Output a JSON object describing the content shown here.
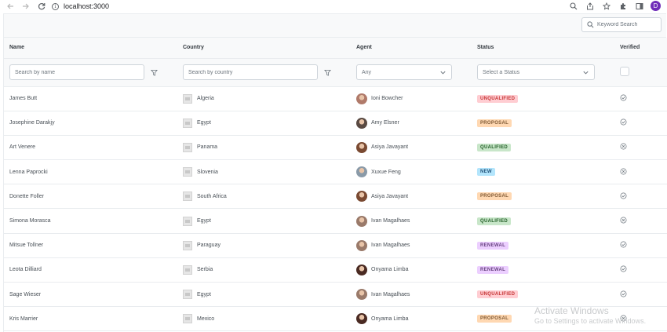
{
  "browser": {
    "url": "localhost:3000",
    "profile_initial": "D",
    "profile_color": "#6f2db8"
  },
  "search": {
    "placeholder": "Keyword Search"
  },
  "columns": {
    "name": "Name",
    "country": "Country",
    "agent": "Agent",
    "status": "Status",
    "verified": "Verified"
  },
  "filters": {
    "name_placeholder": "Search by name",
    "country_placeholder": "Search by country",
    "agent_value": "Any",
    "status_value": "Select a Status"
  },
  "rows": [
    {
      "name": "James Butt",
      "country": "Algeria",
      "agent": "Ioni Bowcher",
      "agent_color": "#b07a6a",
      "status": "UNQUALIFIED",
      "verified": true
    },
    {
      "name": "Josephine Darakjy",
      "country": "Egypt",
      "agent": "Amy Elsner",
      "agent_color": "#5a4a42",
      "status": "PROPOSAL",
      "verified": true
    },
    {
      "name": "Art Venere",
      "country": "Panama",
      "agent": "Asiya Javayant",
      "agent_color": "#7a4a32",
      "status": "QUALIFIED",
      "verified": false
    },
    {
      "name": "Lenna Paprocki",
      "country": "Slovenia",
      "agent": "Xuxue Feng",
      "agent_color": "#8a9aa8",
      "status": "NEW",
      "verified": false
    },
    {
      "name": "Donette Foller",
      "country": "South Africa",
      "agent": "Asiya Javayant",
      "agent_color": "#7a4a32",
      "status": "PROPOSAL",
      "verified": true
    },
    {
      "name": "Simona Morasca",
      "country": "Egypt",
      "agent": "Ivan Magalhaes",
      "agent_color": "#9a7a6a",
      "status": "QUALIFIED",
      "verified": false
    },
    {
      "name": "Mitsue Tollner",
      "country": "Paraguay",
      "agent": "Ivan Magalhaes",
      "agent_color": "#9a7a6a",
      "status": "RENEWAL",
      "verified": true
    },
    {
      "name": "Leota Dilliard",
      "country": "Serbia",
      "agent": "Onyama Limba",
      "agent_color": "#4a2a22",
      "status": "RENEWAL",
      "verified": true
    },
    {
      "name": "Sage Wieser",
      "country": "Egypt",
      "agent": "Ivan Magalhaes",
      "agent_color": "#9a7a6a",
      "status": "UNQUALIFIED",
      "verified": true
    },
    {
      "name": "Kris Marrier",
      "country": "Mexico",
      "agent": "Onyama Limba",
      "agent_color": "#4a2a22",
      "status": "PROPOSAL",
      "verified": false
    }
  ],
  "status_colors": {
    "UNQUALIFIED": {
      "bg": "#ffcdd2",
      "fg": "#c63737"
    },
    "PROPOSAL": {
      "bg": "#ffd8b2",
      "fg": "#805b36"
    },
    "QUALIFIED": {
      "bg": "#c8e6c9",
      "fg": "#256029"
    },
    "NEW": {
      "bg": "#b3e5fc",
      "fg": "#23547b"
    },
    "RENEWAL": {
      "bg": "#eccfff",
      "fg": "#694382"
    }
  },
  "watermark": {
    "title": "Activate Windows",
    "subtitle": "Go to Settings to activate Windows."
  }
}
